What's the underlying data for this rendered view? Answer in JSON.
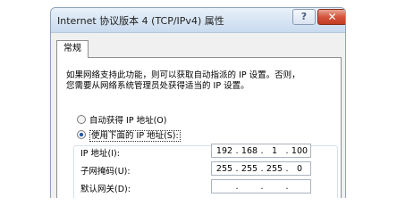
{
  "window": {
    "title": "Internet 协议版本 4 (TCP/IPv4) 属性",
    "help_label": "?",
    "close_label": "✕"
  },
  "tabs": [
    {
      "label": "常规",
      "selected": true
    }
  ],
  "description": {
    "line1": "如果网络支持此功能，则可以获取自动指派的 IP 设置。否则，",
    "line2": "您需要从网络系统管理员处获得适当的 IP 设置。"
  },
  "options": {
    "auto_ip": {
      "label": "自动获得 IP 地址(O)",
      "checked": false
    },
    "manual_ip": {
      "label": "使用下面的 IP 地址(S):",
      "checked": true
    }
  },
  "fields": {
    "ip_address": {
      "label": "IP 地址(I):",
      "octets": [
        "192",
        "168",
        "1",
        "100"
      ]
    },
    "subnet_mask": {
      "label": "子网掩码(U):",
      "octets": [
        "255",
        "255",
        "255",
        "0"
      ]
    },
    "gateway": {
      "label": "默认网关(D):",
      "octets": [
        "",
        "",
        "",
        ""
      ]
    }
  },
  "separator": ".",
  "colors": {
    "dialog_bg": "#f0f0f0",
    "title_bar": "#d6e4f3",
    "close_button": "#c23b22",
    "radio_dot": "#1c4fa0"
  }
}
